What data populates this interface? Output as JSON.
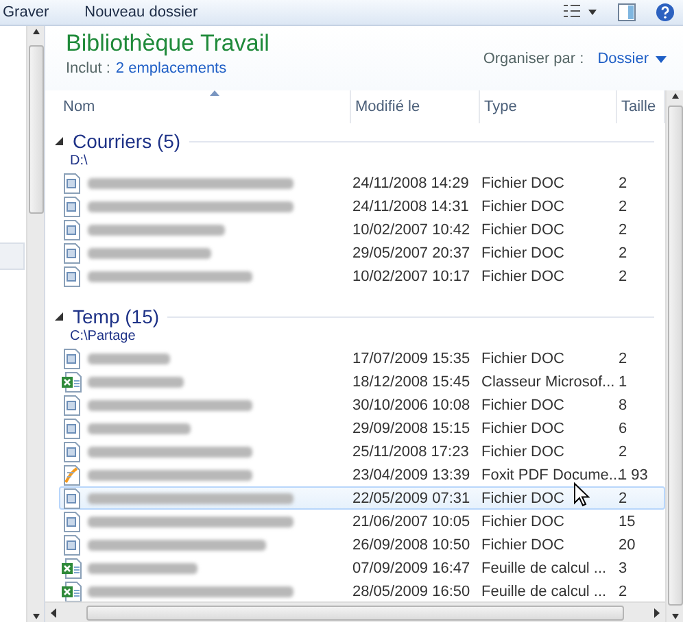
{
  "toolbar": {
    "buttons": [
      "Graver",
      "Nouveau dossier"
    ]
  },
  "library": {
    "title": "Bibliothèque Travail",
    "includes_label": "Inclut :",
    "includes_link": "2 emplacements",
    "arrange_label": "Organiser par :",
    "arrange_value": "Dossier"
  },
  "columns": [
    "Nom",
    "Modifié le",
    "Type",
    "Taille"
  ],
  "groups": [
    {
      "title": "Courriers (5)",
      "path": "D:\\",
      "expanded": true,
      "rows": [
        {
          "kind": "doc",
          "modified": "24/11/2008 14:29",
          "type": "Fichier DOC",
          "size": "2",
          "selected": false
        },
        {
          "kind": "doc",
          "modified": "24/11/2008 14:31",
          "type": "Fichier DOC",
          "size": "2",
          "selected": false
        },
        {
          "kind": "doc",
          "modified": "10/02/2007 10:42",
          "type": "Fichier DOC",
          "size": "2",
          "selected": false
        },
        {
          "kind": "doc",
          "modified": "29/05/2007 20:37",
          "type": "Fichier DOC",
          "size": "2",
          "selected": false
        },
        {
          "kind": "doc",
          "modified": "10/02/2007 10:17",
          "type": "Fichier DOC",
          "size": "2",
          "selected": false
        }
      ]
    },
    {
      "title": "Temp (15)",
      "path": "C:\\Partage",
      "expanded": true,
      "rows": [
        {
          "kind": "doc",
          "modified": "17/07/2009 15:35",
          "type": "Fichier DOC",
          "size": "2",
          "selected": false
        },
        {
          "kind": "xls",
          "modified": "18/12/2008 15:45",
          "type": "Classeur Microsof...",
          "size": "1",
          "selected": false
        },
        {
          "kind": "doc",
          "modified": "30/10/2006 10:08",
          "type": "Fichier DOC",
          "size": "8",
          "selected": false
        },
        {
          "kind": "doc",
          "modified": "29/09/2008 15:15",
          "type": "Fichier DOC",
          "size": "6",
          "selected": false
        },
        {
          "kind": "doc",
          "modified": "25/11/2008 17:23",
          "type": "Fichier DOC",
          "size": "2",
          "selected": false
        },
        {
          "kind": "pdf",
          "modified": "23/04/2009 13:39",
          "type": "Foxit PDF Docume...",
          "size": "1 93",
          "selected": false
        },
        {
          "kind": "doc",
          "modified": "22/05/2009 07:31",
          "type": "Fichier DOC",
          "size": "2",
          "selected": true
        },
        {
          "kind": "doc",
          "modified": "21/06/2007 10:05",
          "type": "Fichier DOC",
          "size": "15",
          "selected": false
        },
        {
          "kind": "doc",
          "modified": "26/09/2008 10:50",
          "type": "Fichier DOC",
          "size": "20",
          "selected": false
        },
        {
          "kind": "xls",
          "modified": "07/09/2009 16:47",
          "type": "Feuille de calcul ...",
          "size": "3",
          "selected": false
        },
        {
          "kind": "xls",
          "modified": "28/05/2009 16:50",
          "type": "Feuille de calcul ...",
          "size": "2",
          "selected": false
        }
      ]
    }
  ]
}
